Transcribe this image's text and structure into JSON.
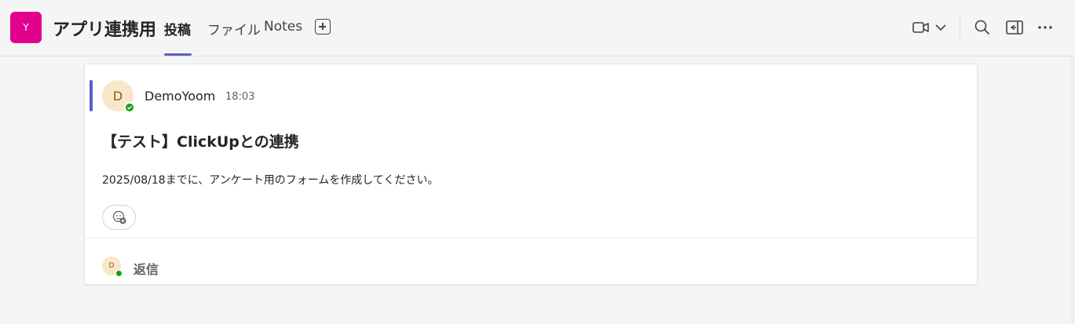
{
  "header": {
    "team_initial": "Y",
    "channel_name": "アプリ連携用",
    "tabs": [
      {
        "label": "投稿",
        "active": true
      },
      {
        "label": "ファイル",
        "active": false
      },
      {
        "label": "Notes",
        "active": false
      }
    ],
    "tools": [
      "video-call-icon",
      "chevron-down-icon",
      "search-icon",
      "open-panel-icon",
      "more-options-icon"
    ]
  },
  "post": {
    "avatar_initial": "D",
    "author": "DemoYoom",
    "time": "18:03",
    "subject": "【テスト】ClickUpとの連携",
    "body": "2025/08/18までに、アンケート用のフォームを作成してください。",
    "reply_avatar_initial": "D",
    "reply_label": "返信"
  },
  "colors": {
    "team_avatar": "#e3008c",
    "accent": "#5b5fc7",
    "presence": "#13a10e",
    "avatar_bg": "#f9e7c9"
  }
}
